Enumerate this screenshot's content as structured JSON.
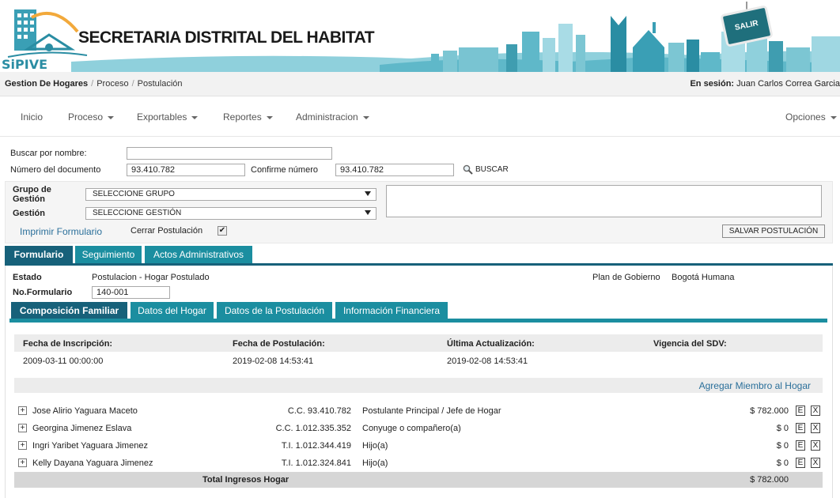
{
  "header": {
    "logo_text": "SiPIVE",
    "title": "SECRETARIA DISTRITAL DEL HABITAT",
    "exit_button": "SALIR"
  },
  "breadcrumb": [
    "Gestion De Hogares",
    "Proceso",
    "Postulación"
  ],
  "session": {
    "label": "En sesión:",
    "user": "Juan Carlos Correa Garcia"
  },
  "nav": {
    "items": [
      "Inicio",
      "Proceso",
      "Exportables",
      "Reportes",
      "Administracion"
    ],
    "options": "Opciones"
  },
  "search": {
    "name_label": "Buscar por nombre:",
    "name_value": "",
    "doc_label": "Número del documento",
    "doc_value": "93.410.782",
    "confirm_label": "Confirme número",
    "confirm_value": "93.410.782",
    "button": "BUSCAR"
  },
  "grupo": {
    "group_label": "Grupo de Gestión",
    "group_value": "SELECCIONE GRUPO",
    "gestion_label": "Gestión",
    "gestion_value": "SELECCIONE GESTIÓN",
    "print_link": "Imprimir Formulario",
    "close_label": "Cerrar Postulación",
    "close_checked": "✔",
    "save_button": "SALVAR POSTULACIÓN"
  },
  "tabs": [
    "Formulario",
    "Seguimiento",
    "Actos Administrativos"
  ],
  "form": {
    "estado_label": "Estado",
    "estado_value": "Postulacion - Hogar Postulado",
    "plan_label": "Plan de Gobierno",
    "plan_value": "Bogotá Humana",
    "no_form_label": "No.Formulario",
    "no_form_value": "140-001"
  },
  "subtabs": [
    "Composición Familiar",
    "Datos del Hogar",
    "Datos de la Postulación",
    "Información Financiera"
  ],
  "dates": {
    "headers": [
      "Fecha de Inscripción:",
      "Fecha de Postulación:",
      "Última Actualización:",
      "Vigencia del SDV:"
    ],
    "values": [
      "2009-03-11 00:00:00",
      "2019-02-08 14:53:41",
      "2019-02-08 14:53:41",
      ""
    ]
  },
  "add_member": "Agregar Miembro al Hogar",
  "members": [
    {
      "name": "Jose Alirio Yaguara Maceto",
      "doc": "C.C. 93.410.782",
      "relation": "Postulante Principal / Jefe de Hogar",
      "income": "$ 782.000"
    },
    {
      "name": "Georgina Jimenez Eslava",
      "doc": "C.C. 1.012.335.352",
      "relation": "Conyuge o compañero(a)",
      "income": "$ 0"
    },
    {
      "name": "Ingri Yaribet Yaguara Jimenez",
      "doc": "T.I. 1.012.344.419",
      "relation": "Hijo(a)",
      "income": "$ 0"
    },
    {
      "name": "Kelly Dayana Yaguara Jimenez",
      "doc": "T.I. 1.012.324.841",
      "relation": "Hijo(a)",
      "income": "$ 0"
    }
  ],
  "row_buttons": {
    "expand": "+",
    "edit": "E",
    "delete": "X"
  },
  "total": {
    "label": "Total Ingresos Hogar",
    "value": "$ 782.000"
  }
}
